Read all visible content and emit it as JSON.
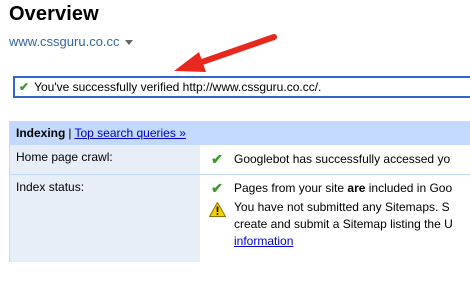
{
  "page": {
    "title": "Overview"
  },
  "site_selector": {
    "value": "www.cssguru.co.cc"
  },
  "success_message": {
    "text": "You've successfully verified http://www.cssguru.co.cc/."
  },
  "panel": {
    "tab_active": "Indexing",
    "separator": "|",
    "tab_link": "Top search queries »",
    "rows": [
      {
        "label": "Home page crawl:",
        "line1": "Googlebot has successfully accessed yo"
      },
      {
        "label": "Index status:",
        "line1_pre": "Pages from your site ",
        "line1_bold": "are",
        "line1_post": " included in Goo",
        "warning_line1": "You have not submitted any Sitemaps. S",
        "warning_line2": "create and submit a Sitemap listing the U",
        "warning_link": "information"
      }
    ]
  },
  "colors": {
    "accent_border": "#3366cc",
    "header_bg": "#c3d9ff",
    "label_bg": "#e8eef7",
    "arrow": "#e8281e",
    "link": "#0000cc"
  },
  "icons": [
    "checkmark-icon",
    "warning-icon",
    "dropdown-caret-icon",
    "red-arrow-annotation"
  ]
}
